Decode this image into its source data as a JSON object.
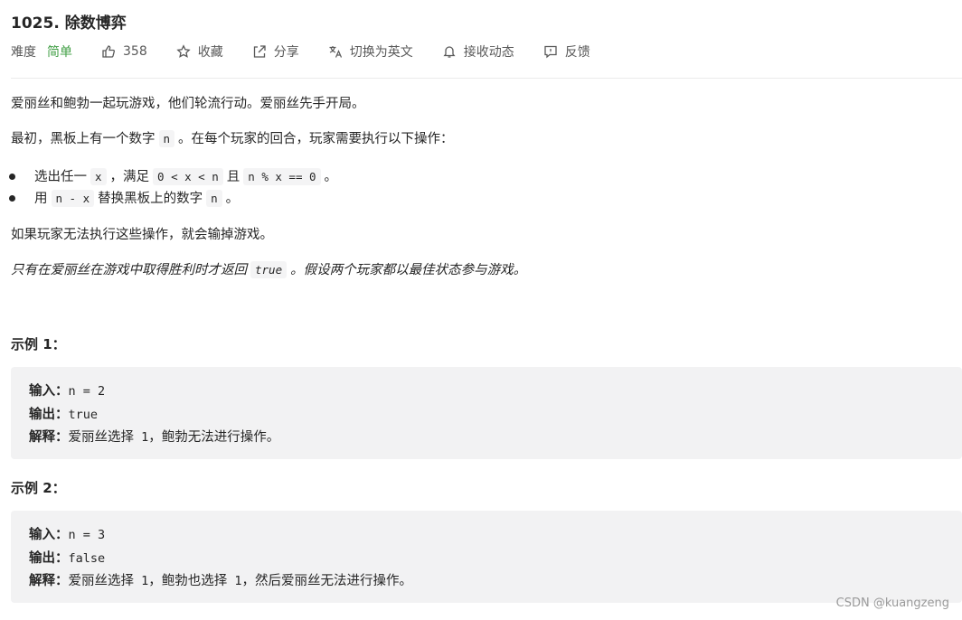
{
  "problem": {
    "title": "1025. 除数博弈",
    "difficulty_label": "难度",
    "difficulty": "简单",
    "likes": "358",
    "actions": {
      "favorite": "收藏",
      "share": "分享",
      "switch_lang": "切换为英文",
      "notify": "接收动态",
      "feedback": "反馈"
    }
  },
  "description": {
    "p1": "爱丽丝和鲍勃一起玩游戏，他们轮流行动。爱丽丝先手开局。",
    "p2_before": "最初，黑板上有一个数字",
    "p2_code": "n",
    "p2_after": "。在每个玩家的回合，玩家需要执行以下操作：",
    "bullet1_a": "选出任一",
    "bullet1_code1": "x",
    "bullet1_b": "，满足",
    "bullet1_code2": "0 < x < n",
    "bullet1_c": "且",
    "bullet1_code3": "n % x == 0",
    "bullet1_d": "。",
    "bullet2_a": "用",
    "bullet2_code1": "n - x",
    "bullet2_b": "替换黑板上的数字",
    "bullet2_code2": "n",
    "bullet2_c": "。",
    "p3": "如果玩家无法执行这些操作，就会输掉游戏。",
    "p4_before": "只有在爱丽丝在游戏中取得胜利时才返回",
    "p4_code": "true",
    "p4_after": "。假设两个玩家都以最佳状态参与游戏。"
  },
  "examples": [
    {
      "title": "示例 1：",
      "input_label": "输入：",
      "input": "n = 2",
      "output_label": "输出：",
      "output": "true",
      "explain_label": "解释：",
      "explain_a": "爱丽丝选择",
      "explain_num": " 1",
      "explain_b": "，鲍勃无法进行操作。"
    },
    {
      "title": "示例 2：",
      "input_label": "输入：",
      "input": "n = 3",
      "output_label": "输出：",
      "output": "false",
      "explain_label": "解释：",
      "explain_a": "爱丽丝选择",
      "explain_num": " 1",
      "explain_b": "，鲍勃也选择",
      "explain_num2": " 1",
      "explain_c": "，然后爱丽丝无法进行操作。"
    }
  ],
  "watermark": "CSDN @kuangzeng",
  "colors": {
    "easy": "#43a047",
    "code_bg": "#f4f4f5",
    "example_bg": "#f2f2f3"
  }
}
